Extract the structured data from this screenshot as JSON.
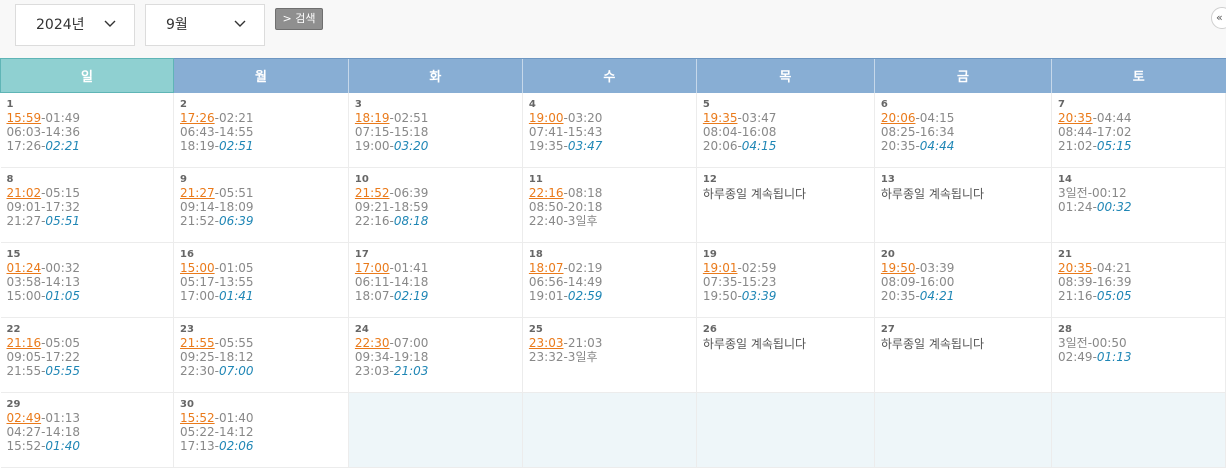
{
  "controls": {
    "year": "2024년",
    "month": "9월",
    "search_label": "> 검색",
    "collapse_label": "«"
  },
  "colors": {
    "header_weekday": "#88aed4",
    "header_sunday": "#8fd0d1",
    "time_orange": "#ea7a1a",
    "time_blue": "#1f86b5",
    "empty_cell": "#eef6f9"
  },
  "weekdays": [
    "일",
    "월",
    "화",
    "수",
    "목",
    "금",
    "토"
  ],
  "weeks": [
    [
      {
        "day": "1",
        "type": "t",
        "l1": [
          "15:59",
          "-01:49"
        ],
        "l2": "06:03-14:36",
        "l3": [
          "17:26-",
          "02:21"
        ]
      },
      {
        "day": "2",
        "type": "t",
        "l1": [
          "17:26",
          "-02:21"
        ],
        "l2": "06:43-14:55",
        "l3": [
          "18:19-",
          "02:51"
        ]
      },
      {
        "day": "3",
        "type": "t",
        "l1": [
          "18:19",
          "-02:51"
        ],
        "l2": "07:15-15:18",
        "l3": [
          "19:00-",
          "03:20"
        ]
      },
      {
        "day": "4",
        "type": "t",
        "l1": [
          "19:00",
          "-03:20"
        ],
        "l2": "07:41-15:43",
        "l3": [
          "19:35-",
          "03:47"
        ]
      },
      {
        "day": "5",
        "type": "t",
        "l1": [
          "19:35",
          "-03:47"
        ],
        "l2": "08:04-16:08",
        "l3": [
          "20:06-",
          "04:15"
        ]
      },
      {
        "day": "6",
        "type": "t",
        "l1": [
          "20:06",
          "-04:15"
        ],
        "l2": "08:25-16:34",
        "l3": [
          "20:35-",
          "04:44"
        ]
      },
      {
        "day": "7",
        "type": "t",
        "l1": [
          "20:35",
          "-04:44"
        ],
        "l2": "08:44-17:02",
        "l3": [
          "21:02-",
          "05:15"
        ]
      }
    ],
    [
      {
        "day": "8",
        "type": "t",
        "l1": [
          "21:02",
          "-05:15"
        ],
        "l2": "09:01-17:32",
        "l3": [
          "21:27-",
          "05:51"
        ]
      },
      {
        "day": "9",
        "type": "t",
        "l1": [
          "21:27",
          "-05:51"
        ],
        "l2": "09:14-18:09",
        "l3": [
          "21:52-",
          "06:39"
        ]
      },
      {
        "day": "10",
        "type": "t",
        "l1": [
          "21:52",
          "-06:39"
        ],
        "l2": "09:21-18:59",
        "l3": [
          "22:16-",
          "08:18"
        ]
      },
      {
        "day": "11",
        "type": "t",
        "l1": [
          "22:16",
          "-08:18"
        ],
        "l2": "08:50-20:18",
        "l3g": "22:40-3일후"
      },
      {
        "day": "12",
        "type": "a",
        "text": "하루종일 계속됩니다"
      },
      {
        "day": "13",
        "type": "a",
        "text": "하루종일 계속됩니다"
      },
      {
        "day": "14",
        "type": "s",
        "l1g": "3일전-00:12",
        "l2b": [
          "01:24-",
          "00:32"
        ]
      }
    ],
    [
      {
        "day": "15",
        "type": "t",
        "l1": [
          "01:24",
          "-00:32"
        ],
        "l2": "03:58-14:13",
        "l3": [
          "15:00-",
          "01:05"
        ]
      },
      {
        "day": "16",
        "type": "t",
        "l1": [
          "15:00",
          "-01:05"
        ],
        "l2": "05:17-13:55",
        "l3": [
          "17:00-",
          "01:41"
        ]
      },
      {
        "day": "17",
        "type": "t",
        "l1": [
          "17:00",
          "-01:41"
        ],
        "l2": "06:11-14:18",
        "l3": [
          "18:07-",
          "02:19"
        ]
      },
      {
        "day": "18",
        "type": "t",
        "l1": [
          "18:07",
          "-02:19"
        ],
        "l2": "06:56-14:49",
        "l3": [
          "19:01-",
          "02:59"
        ]
      },
      {
        "day": "19",
        "type": "t",
        "l1": [
          "19:01",
          "-02:59"
        ],
        "l2": "07:35-15:23",
        "l3": [
          "19:50-",
          "03:39"
        ]
      },
      {
        "day": "20",
        "type": "t",
        "l1": [
          "19:50",
          "-03:39"
        ],
        "l2": "08:09-16:00",
        "l3": [
          "20:35-",
          "04:21"
        ]
      },
      {
        "day": "21",
        "type": "t",
        "l1": [
          "20:35",
          "-04:21"
        ],
        "l2": "08:39-16:39",
        "l3": [
          "21:16-",
          "05:05"
        ]
      }
    ],
    [
      {
        "day": "22",
        "type": "t",
        "l1": [
          "21:16",
          "-05:05"
        ],
        "l2": "09:05-17:22",
        "l3": [
          "21:55-",
          "05:55"
        ]
      },
      {
        "day": "23",
        "type": "t",
        "l1": [
          "21:55",
          "-05:55"
        ],
        "l2": "09:25-18:12",
        "l3": [
          "22:30-",
          "07:00"
        ]
      },
      {
        "day": "24",
        "type": "t",
        "l1": [
          "22:30",
          "-07:00"
        ],
        "l2": "09:34-19:18",
        "l3": [
          "23:03-",
          "21:03"
        ]
      },
      {
        "day": "25",
        "type": "t",
        "l1": [
          "23:03",
          "-21:03"
        ],
        "l2": "23:32-3일후"
      },
      {
        "day": "26",
        "type": "a",
        "text": "하루종일 계속됩니다"
      },
      {
        "day": "27",
        "type": "a",
        "text": "하루종일 계속됩니다"
      },
      {
        "day": "28",
        "type": "s",
        "l1g": "3일전-00:50",
        "l2b": [
          "02:49-",
          "01:13"
        ]
      }
    ],
    [
      {
        "day": "29",
        "type": "t",
        "l1": [
          "02:49",
          "-01:13"
        ],
        "l2": "04:27-14:18",
        "l3": [
          "15:52-",
          "01:40"
        ]
      },
      {
        "day": "30",
        "type": "t",
        "l1": [
          "15:52",
          "-01:40"
        ],
        "l2": "05:22-14:12",
        "l3": [
          "17:13-",
          "02:06"
        ]
      },
      {
        "day": "",
        "type": "e"
      },
      {
        "day": "",
        "type": "e"
      },
      {
        "day": "",
        "type": "e"
      },
      {
        "day": "",
        "type": "e"
      },
      {
        "day": "",
        "type": "e"
      }
    ]
  ]
}
